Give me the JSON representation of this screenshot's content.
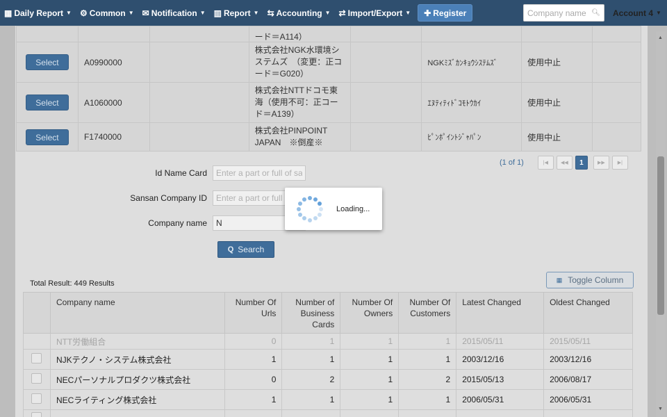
{
  "nav": {
    "daily_report": "Daily Report",
    "common": "Common",
    "notification": "Notification",
    "report": "Report",
    "accounting": "Accounting",
    "import_export": "Import/Export",
    "register": "Register",
    "company_search_placeholder": "Company name",
    "account": "Account 4"
  },
  "top_table": {
    "partial_name": "ード＝A114）",
    "rows": [
      {
        "button": "Select",
        "code": "A0990000",
        "name": "株式会社NGK水環境システムズ　（変更：正コード＝G020）",
        "kana": "NGKﾐｽﾞｶﾝｷｮｳｼｽﾃﾑｽﾞ",
        "status": "使用中止"
      },
      {
        "button": "Select",
        "code": "A1060000",
        "name": "株式会社NTTドコモ東海（使用不可：正コード＝A139）",
        "kana": "ｴﾇﾃｨﾃｨﾄﾞｺﾓﾄｳｶｲ",
        "status": "使用中止"
      },
      {
        "button": "Select",
        "code": "F1740000",
        "name": "株式会社PINPOINT JAPAN　※倒産※",
        "kana": "ﾋﾟﾝﾎﾟｲﾝﾄｼﾞｬﾊﾟﾝ",
        "status": "使用中止"
      }
    ]
  },
  "pager": {
    "info": "(1 of 1)",
    "first": "|◀",
    "prev": "◀◀",
    "page": "1",
    "next": "▶▶",
    "last": "▶|"
  },
  "form": {
    "id_name_card_label": "Id Name Card",
    "id_name_card_placeholder": "Enter a part or full of sar",
    "sansan_label": "Sansan Company ID",
    "sansan_placeholder": "Enter a part or full of sar",
    "company_label": "Company name",
    "company_value": "N",
    "search_button": "Search"
  },
  "loading_text": "Loading...",
  "results": {
    "total": "Total Result: 449 Results",
    "toggle_button": "Toggle Column",
    "headers": [
      "Company name",
      "Number Of Urls",
      "Number of Business Cards",
      "Number Of Owners",
      "Number Of Customers",
      "Latest Changed",
      "Oldest Changed"
    ],
    "rows": [
      {
        "name": "NTT労働組合",
        "urls": "0",
        "cards": "1",
        "owners": "1",
        "customers": "1",
        "latest": "2015/05/11",
        "oldest": "2015/05/11"
      },
      {
        "name": "NJKテクノ・システム株式会社",
        "urls": "1",
        "cards": "1",
        "owners": "1",
        "customers": "1",
        "latest": "2003/12/16",
        "oldest": "2003/12/16"
      },
      {
        "name": "NECパーソナルプロダクツ株式会社",
        "urls": "0",
        "cards": "2",
        "owners": "1",
        "customers": "2",
        "latest": "2015/05/13",
        "oldest": "2006/08/17"
      },
      {
        "name": "NECライティング株式会社",
        "urls": "1",
        "cards": "1",
        "owners": "1",
        "customers": "1",
        "latest": "2006/05/31",
        "oldest": "2006/05/31"
      }
    ]
  },
  "colors": {
    "navbar": "#2f4f6f",
    "primary": "#3f6d9a",
    "spinner": "#5a9bd8"
  }
}
